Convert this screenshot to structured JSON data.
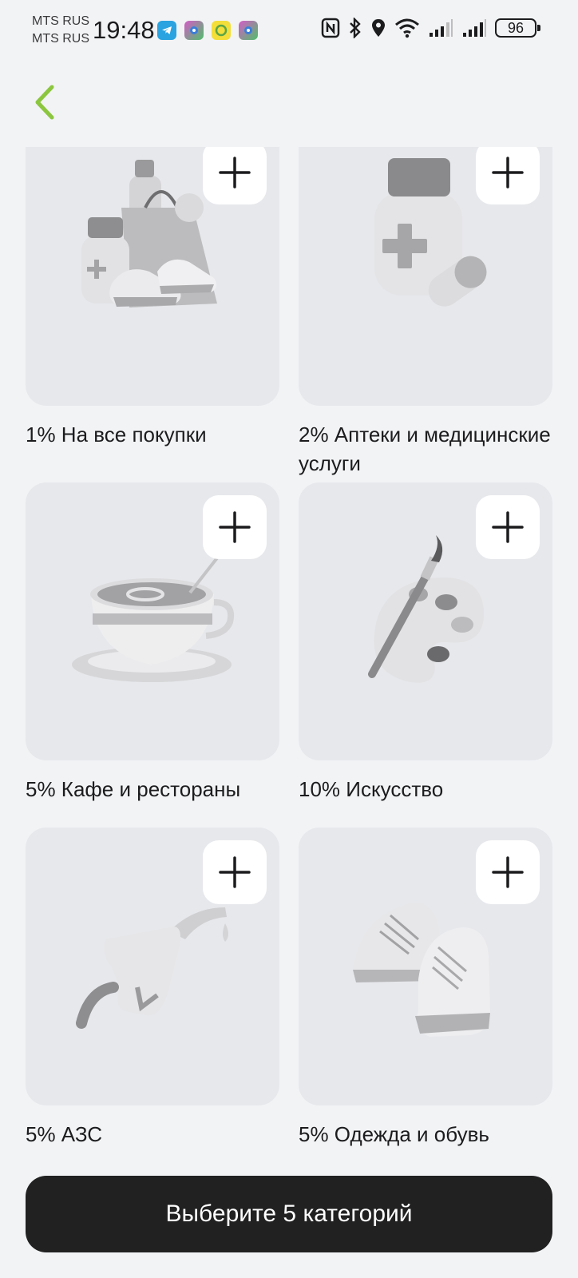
{
  "status_bar": {
    "carrier_1": "MTS RUS",
    "carrier_2": "MTS RUS",
    "time": "19:48",
    "battery": "96",
    "app_icons": [
      "telegram-icon",
      "app-icon-1",
      "app-icon-2",
      "app-icon-3"
    ],
    "icons": [
      "nfc-icon",
      "bluetooth-icon",
      "location-icon",
      "wifi-icon",
      "signal-icon",
      "signal-icon"
    ]
  },
  "header": {
    "back_icon": "chevron-left-icon",
    "accent_color": "#8cc63f"
  },
  "categories": [
    {
      "label": "1% На все покупки",
      "icon": "shopping-bag-icon"
    },
    {
      "label": "2% Аптеки и медицинские услуги",
      "icon": "medicine-bottle-icon"
    },
    {
      "label": "5% Кафе и рестораны",
      "icon": "coffee-cup-icon"
    },
    {
      "label": "10% Искусство",
      "icon": "paint-palette-icon"
    },
    {
      "label": "5% АЗС",
      "icon": "fuel-nozzle-icon"
    },
    {
      "label": "5% Одежда и обувь",
      "icon": "sneakers-icon"
    }
  ],
  "footer": {
    "button_label": "Выберите 5 категорий",
    "button_color": "#212121"
  }
}
